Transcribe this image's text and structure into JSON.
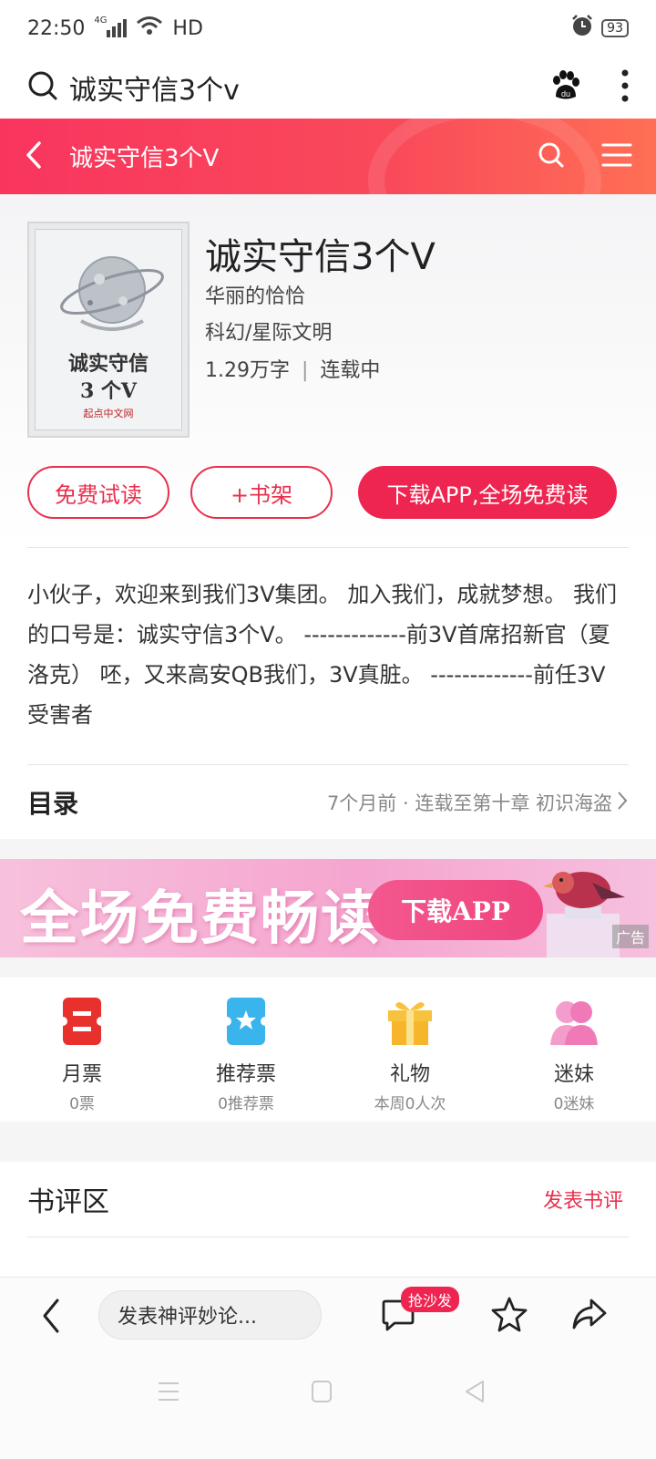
{
  "status_bar": {
    "time": "22:50",
    "network": "4G",
    "network_badge": "HD",
    "battery": "93"
  },
  "browser": {
    "query": "诚实守信3个v"
  },
  "header": {
    "title": "诚实守信3个V"
  },
  "book": {
    "cover_title_line1": "诚实守信",
    "cover_title_line2": "3 个V",
    "cover_publisher": "起点中文网",
    "title": "诚实守信3个V",
    "author": "华丽的恰恰",
    "genre": "科幻/星际文明",
    "word_count": "1.29万字",
    "status": "连载中"
  },
  "actions": {
    "trial": "免费试读",
    "shelf": "+书架",
    "download": "下载APP,全场免费读"
  },
  "intro": "小伙子，欢迎来到我们3V集团。 加入我们，成就梦想。 我们的口号是：诚实守信3个V。 -------------前3V首席招新官（夏洛克） 呸，又来高安QB我们，3V真脏。 -------------前任3V受害者",
  "toc": {
    "title": "目录",
    "meta": "7个月前 · 连载至第十章 初识海盗"
  },
  "ad": {
    "headline": "全场免费畅读",
    "button": "下载APP",
    "tag": "广告"
  },
  "votes": [
    {
      "label": "月票",
      "count": "0票",
      "icon": "monthly-ticket-icon",
      "color": "#e8302c"
    },
    {
      "label": "推荐票",
      "count": "0推荐票",
      "icon": "recommend-ticket-icon",
      "color": "#3ab4ec"
    },
    {
      "label": "礼物",
      "count": "本周0人次",
      "icon": "gift-icon",
      "color": "#f6b52a"
    },
    {
      "label": "迷妹",
      "count": "0迷妹",
      "icon": "fans-icon",
      "color": "#f07ab8"
    }
  ],
  "reviews": {
    "title": "书评区",
    "post": "发表书评"
  },
  "bottom_bar": {
    "comment_placeholder": "发表神评妙论...",
    "sofa_badge": "抢沙发"
  },
  "colors": {
    "accent": "#ee2550",
    "header_start": "#f9355e",
    "header_end": "#ff6f55"
  }
}
